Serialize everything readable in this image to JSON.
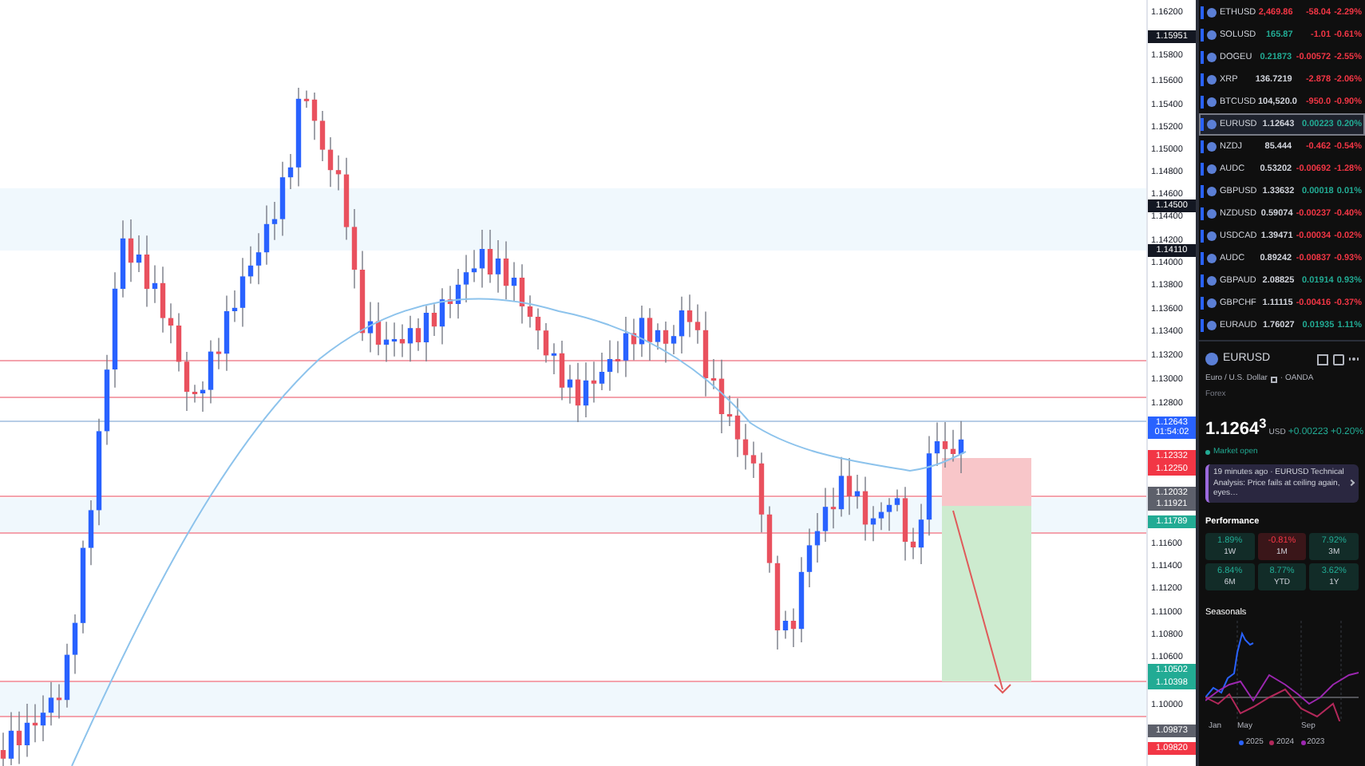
{
  "price_axis": {
    "labels": [
      {
        "text": "1.16200",
        "kind": "plain"
      },
      {
        "text": "1.15951",
        "kind": "tag",
        "color": "#131722"
      },
      {
        "text": "1.15800",
        "kind": "plain"
      },
      {
        "text": "1.15600",
        "kind": "plain"
      },
      {
        "text": "1.15400",
        "kind": "plain"
      },
      {
        "text": "1.15200",
        "kind": "plain"
      },
      {
        "text": "1.15000",
        "kind": "plain"
      },
      {
        "text": "1.14800",
        "kind": "plain"
      },
      {
        "text": "1.14600",
        "kind": "plain"
      },
      {
        "text": "1.14500",
        "kind": "tag",
        "color": "#131722"
      },
      {
        "text": "1.14400",
        "kind": "plain"
      },
      {
        "text": "1.14200",
        "kind": "plain"
      },
      {
        "text": "1.14110",
        "kind": "tag",
        "color": "#131722"
      },
      {
        "text": "1.14000",
        "kind": "plain"
      },
      {
        "text": "1.13800",
        "kind": "plain"
      },
      {
        "text": "1.13600",
        "kind": "plain"
      },
      {
        "text": "1.13400",
        "kind": "plain"
      },
      {
        "text": "1.13200",
        "kind": "plain"
      },
      {
        "text": "1.13000",
        "kind": "plain"
      },
      {
        "text": "1.12800",
        "kind": "plain"
      },
      {
        "text": "1.12643",
        "kind": "tag",
        "color": "#2962ff"
      },
      {
        "text": "01:54:02",
        "kind": "tag",
        "color": "#2962ff"
      },
      {
        "text": "1.12332",
        "kind": "tag",
        "color": "#f23645"
      },
      {
        "text": "1.12250",
        "kind": "tag",
        "color": "#f23645"
      },
      {
        "text": "1.12032",
        "kind": "tag",
        "color": "#5d606b"
      },
      {
        "text": "1.11921",
        "kind": "tag",
        "color": "#5d606b"
      },
      {
        "text": "1.11789",
        "kind": "tag",
        "color": "#22ab94"
      },
      {
        "text": "1.11600",
        "kind": "plain"
      },
      {
        "text": "1.11400",
        "kind": "plain"
      },
      {
        "text": "1.11200",
        "kind": "plain"
      },
      {
        "text": "1.11000",
        "kind": "plain"
      },
      {
        "text": "1.10800",
        "kind": "plain"
      },
      {
        "text": "1.10600",
        "kind": "plain"
      },
      {
        "text": "1.10502",
        "kind": "tag",
        "color": "#22ab94"
      },
      {
        "text": "1.10398",
        "kind": "tag",
        "color": "#22ab94"
      },
      {
        "text": "1.10000",
        "kind": "plain"
      },
      {
        "text": "1.09873",
        "kind": "tag",
        "color": "#5d606b"
      },
      {
        "text": "1.09820",
        "kind": "tag",
        "color": "#f23645"
      }
    ]
  },
  "watchlist": [
    {
      "symbol": "ETHUSD",
      "last": {
        "text": "2,469.86",
        "color": "#f23645"
      },
      "change": "-58.04",
      "change_pct": "-2.29%",
      "color": "#f23645",
      "selected": false
    },
    {
      "symbol": "SOLUSD",
      "last": {
        "text": "165.87",
        "color": "#22ab94"
      },
      "change": "-1.01",
      "change_pct": "-0.61%",
      "color": "#f23645",
      "selected": false
    },
    {
      "symbol": "DOGEU",
      "last": {
        "text": "0.21873",
        "color": "#22ab94"
      },
      "change": "-0.00572",
      "change_pct": "-2.55%",
      "color": "#f23645",
      "selected": false
    },
    {
      "symbol": "XRP",
      "last": {
        "text": "136.7219",
        "color": "#d1d4dc"
      },
      "change": "-2.878",
      "change_pct": "-2.06%",
      "color": "#f23645",
      "selected": false
    },
    {
      "symbol": "BTCUSD",
      "last": {
        "text": "104,520.0",
        "color": "#d1d4dc"
      },
      "change": "-950.0",
      "change_pct": "-0.90%",
      "color": "#f23645",
      "selected": false
    },
    {
      "symbol": "EURUSD",
      "last": {
        "text": "1.12643",
        "color": "#d1d4dc"
      },
      "change": "0.00223",
      "change_pct": "0.20%",
      "color": "#22ab94",
      "selected": true
    },
    {
      "symbol": "NZDJ",
      "last": {
        "text": "85.444",
        "color": "#d1d4dc"
      },
      "change": "-0.462",
      "change_pct": "-0.54%",
      "color": "#f23645",
      "selected": false
    },
    {
      "symbol": "AUDC",
      "last": {
        "text": "0.53202",
        "color": "#d1d4dc"
      },
      "change": "-0.00692",
      "change_pct": "-1.28%",
      "color": "#f23645",
      "selected": false
    },
    {
      "symbol": "GBPUSD",
      "last": {
        "text": "1.33632",
        "color": "#d1d4dc"
      },
      "change": "0.00018",
      "change_pct": "0.01%",
      "color": "#22ab94",
      "selected": false
    },
    {
      "symbol": "NZDUSD",
      "last": {
        "text": "0.59074",
        "color": "#d1d4dc"
      },
      "change": "-0.00237",
      "change_pct": "-0.40%",
      "color": "#f23645",
      "selected": false
    },
    {
      "symbol": "USDCAD",
      "last": {
        "text": "1.39471",
        "color": "#d1d4dc"
      },
      "change": "-0.00034",
      "change_pct": "-0.02%",
      "color": "#f23645",
      "selected": false
    },
    {
      "symbol": "AUDC",
      "last": {
        "text": "0.89242",
        "color": "#d1d4dc"
      },
      "change": "-0.00837",
      "change_pct": "-0.93%",
      "color": "#f23645",
      "selected": false
    },
    {
      "symbol": "GBPAUD",
      "last": {
        "text": "2.08825",
        "color": "#d1d4dc"
      },
      "change": "0.01914",
      "change_pct": "0.93%",
      "color": "#22ab94",
      "selected": false
    },
    {
      "symbol": "GBPCHF",
      "last": {
        "text": "1.11115",
        "color": "#d1d4dc"
      },
      "change": "-0.00416",
      "change_pct": "-0.37%",
      "color": "#f23645",
      "selected": false
    },
    {
      "symbol": "EURAUD",
      "last": {
        "text": "1.76027",
        "color": "#d1d4dc"
      },
      "change": "0.01935",
      "change_pct": "1.11%",
      "color": "#22ab94",
      "selected": false
    }
  ],
  "details": {
    "symbol": "EURUSD",
    "description": "Euro / U.S. Dollar",
    "exchange": "· OANDA",
    "category": "Forex",
    "price": "1.1264$^{3}$",
    "currency": "USD",
    "change": "+0.00223",
    "change_pct": "+0.20%",
    "market_status": "Market open",
    "news": "19 minutes ago · EURUSD Technical Analysis: Price fails at ceiling again, eyes…",
    "performance_title": "Performance",
    "performance": [
      {
        "value": "1.89%",
        "period": "1W",
        "color": "#22ab94"
      },
      {
        "value": "-0.81%",
        "period": "1M",
        "color": "#f23645"
      },
      {
        "value": "7.92%",
        "period": "3M",
        "color": "#22ab94"
      },
      {
        "value": "6.84%",
        "period": "6M",
        "color": "#22ab94"
      },
      {
        "value": "8.77%",
        "period": "YTD",
        "color": "#22ab94"
      },
      {
        "value": "3.62%",
        "period": "1Y",
        "color": "#22ab94"
      }
    ],
    "seasonals_title": "Seasonals",
    "seasonals_months": [
      "Jan",
      "May",
      "Sep"
    ],
    "seasonals_legend": [
      {
        "label": "2025",
        "color": "#2962ff"
      },
      {
        "label": "2024",
        "color": "#b2285a"
      },
      {
        "label": "2023",
        "color": "#9c27b0"
      }
    ]
  }
}
